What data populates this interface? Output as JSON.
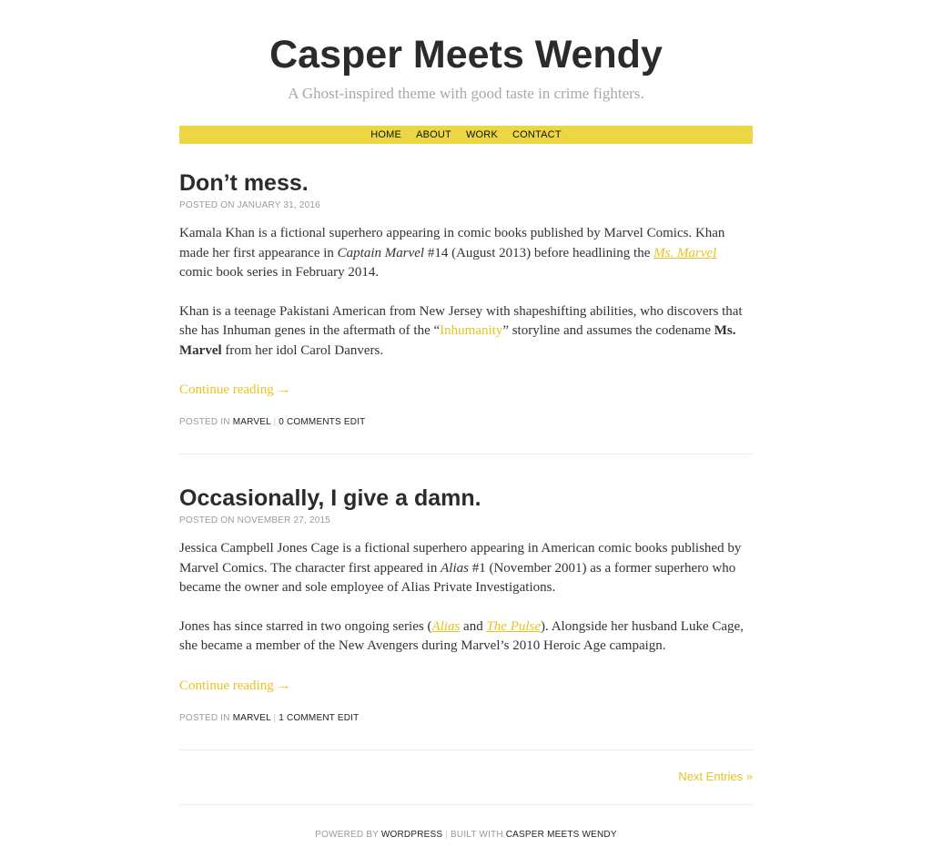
{
  "site": {
    "title": "Casper Meets Wendy",
    "description": "A Ghost-inspired theme with good taste in crime fighters."
  },
  "nav": {
    "items": [
      "HOME",
      "ABOUT",
      "WORK",
      "CONTACT"
    ]
  },
  "colors": {
    "accent": "#ecd644",
    "link": "#e5c520"
  },
  "posts": [
    {
      "title": "Don’t mess.",
      "meta": "POSTED ON JANUARY 31, 2016",
      "p1_a": "Kamala Khan is a fictional superhero appearing in comic books published by Marvel Comics. Khan made her first appearance in ",
      "p1_italic": "Captain Marvel",
      "p1_b": " #14 (August 2013) before headlining the ",
      "p1_link": "Ms. Marvel",
      "p1_c": " comic book series in February 2014.",
      "p2_a": "Khan is a teenage Pakistani American from New Jersey with shapeshifting abilities, who discovers that she has Inhuman genes in the aftermath of the “",
      "p2_link": "Inhumanity",
      "p2_b": "” storyline and assumes the codename ",
      "p2_bold": "Ms. Marvel",
      "p2_c": " from her idol Carol Danvers.",
      "continue": "Continue reading →",
      "posted_in": "POSTED IN",
      "category": "MARVEL",
      "comments": "0 COMMENTS",
      "edit": "EDIT"
    },
    {
      "title": "Occasionally, I give a damn.",
      "meta": "POSTED ON NOVEMBER 27, 2015",
      "p1_a": "Jessica Campbell Jones Cage is a fictional superhero appearing in American comic books published by Marvel Comics. The character first appeared in ",
      "p1_italic": "Alias",
      "p1_b": " #1 (November 2001) as a former superhero who became the owner and sole employee of Alias Private Investigations.",
      "p2_a": "Jones has since starred in two ongoing series (",
      "p2_link1": "Alias",
      "p2_and": " and ",
      "p2_link2": "The Pulse",
      "p2_b": "). Alongside her husband Luke Cage, she became a member of the New Avengers during Marvel’s 2010 Heroic Age campaign.",
      "continue": "Continue reading →",
      "posted_in": "POSTED IN",
      "category": "MARVEL",
      "comments": "1 COMMENT",
      "edit": "EDIT"
    }
  ],
  "pagination": {
    "next": "Next Entries »"
  },
  "footer": {
    "powered_by": "POWERED BY",
    "wordpress": "WORDPRESS",
    "built_with": "BUILT WITH",
    "theme": "CASPER MEETS WENDY"
  }
}
